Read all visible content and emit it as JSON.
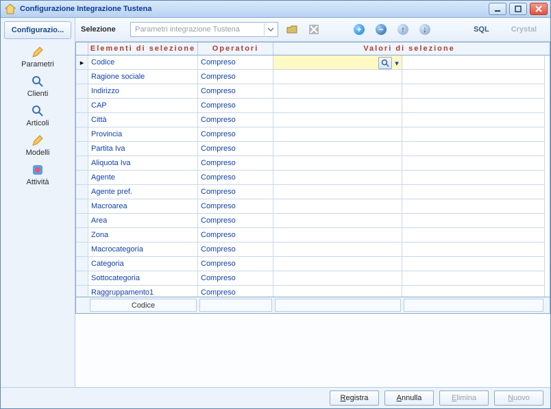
{
  "window": {
    "title": "Configurazione Integrazione Tustena"
  },
  "sidebar": {
    "header": "Configurazio...",
    "items": [
      {
        "label": "Parametri"
      },
      {
        "label": "Clienti"
      },
      {
        "label": "Articoli"
      },
      {
        "label": "Modelli"
      },
      {
        "label": "Attività"
      }
    ]
  },
  "toolbar": {
    "selection_label": "Selezione",
    "selection_placeholder": "Parametri integrazione Tustena",
    "sql_label": "SQL",
    "crystal_label": "Crystal",
    "add_glyph": "+",
    "remove_glyph": "−",
    "up_glyph": "↑",
    "down_glyph": "↓"
  },
  "grid": {
    "columns": {
      "elements": "Elementi di selezione",
      "operators": "Operatori",
      "values": "Valori di selezione"
    },
    "rows": [
      {
        "element": "Codice",
        "operator": "Compreso",
        "active": true
      },
      {
        "element": "Ragione sociale",
        "operator": "Compreso"
      },
      {
        "element": "Indirizzo",
        "operator": "Compreso"
      },
      {
        "element": "CAP",
        "operator": "Compreso"
      },
      {
        "element": "Città",
        "operator": "Compreso"
      },
      {
        "element": "Provincia",
        "operator": "Compreso"
      },
      {
        "element": "Partita Iva",
        "operator": "Compreso"
      },
      {
        "element": "Aliquota Iva",
        "operator": "Compreso"
      },
      {
        "element": "Agente",
        "operator": "Compreso"
      },
      {
        "element": "Agente pref.",
        "operator": "Compreso"
      },
      {
        "element": "Macroarea",
        "operator": "Compreso"
      },
      {
        "element": "Area",
        "operator": "Compreso"
      },
      {
        "element": "Zona",
        "operator": "Compreso"
      },
      {
        "element": "Macrocategoria",
        "operator": "Compreso"
      },
      {
        "element": "Categoria",
        "operator": "Compreso"
      },
      {
        "element": "Sottocategoria",
        "operator": "Compreso"
      },
      {
        "element": "Raggruppamento1",
        "operator": "Compreso"
      }
    ],
    "footer_label": "Codice"
  },
  "footer": {
    "register": "Registra",
    "cancel": "Annulla",
    "delete": "Elimina",
    "new": "Nuovo"
  }
}
